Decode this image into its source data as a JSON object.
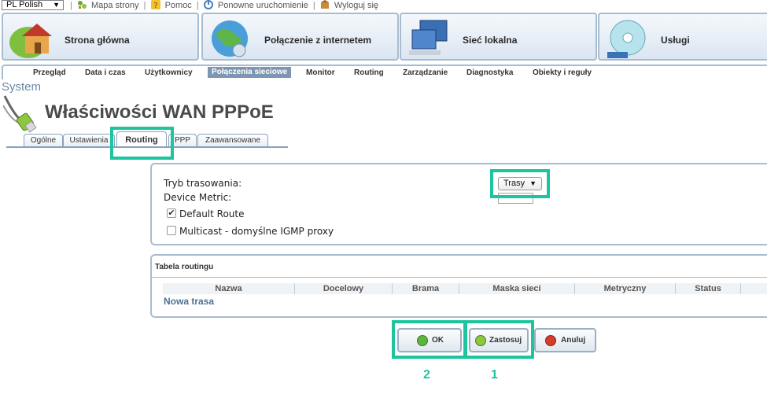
{
  "topbar": {
    "language": "PL Polish",
    "links": [
      "Mapa strony",
      "Pomoc",
      "Ponowne uruchomienie",
      "Wyloguj się"
    ]
  },
  "main_nav": [
    {
      "label": "Strona główna",
      "icon": "house-icon"
    },
    {
      "label": "Połączenie z internetem",
      "icon": "globe-icon"
    },
    {
      "label": "Sieć lokalna",
      "icon": "network-computers-icon"
    },
    {
      "label": "Usługi",
      "icon": "cd-disc-icon"
    }
  ],
  "sub_nav": [
    {
      "label": "Przegląd"
    },
    {
      "label": "Data i czas"
    },
    {
      "label": "Użytkownicy"
    },
    {
      "label": "Połączenia sieciowe",
      "active": true
    },
    {
      "label": "Monitor"
    },
    {
      "label": "Routing"
    },
    {
      "label": "Zarządzanie"
    },
    {
      "label": "Diagnostyka"
    },
    {
      "label": "Obiekty i reguły"
    }
  ],
  "section_label": "System",
  "page_title": "Właściwości WAN PPPoE",
  "tabs": [
    {
      "label": "Ogólne"
    },
    {
      "label": "Ustawienia"
    },
    {
      "label": "Routing",
      "active": true
    },
    {
      "label": "PPP"
    },
    {
      "label": "Zaawansowane"
    }
  ],
  "form": {
    "routing_mode_label": "Tryb trasowania:",
    "routing_mode_value": "Trasy",
    "device_metric_label": "Device Metric:",
    "device_metric_value": "",
    "default_route_label": "Default Route",
    "default_route_checked": true,
    "multicast_label": "Multicast - domyślne IGMP proxy",
    "multicast_checked": false
  },
  "routing_table": {
    "title": "Tabela routingu",
    "columns": [
      "Nazwa",
      "Docelowy",
      "Brama",
      "Maska sieci",
      "Metryczny",
      "Status"
    ],
    "new_route_link": "Nowa trasa"
  },
  "buttons": {
    "ok": "OK",
    "apply": "Zastosuj",
    "cancel": "Anuluj"
  },
  "annotations": {
    "ok_step": "2",
    "apply_step": "1",
    "highlight_color": "#1ec49e"
  },
  "colors": {
    "accent_border": "#a8bcd0",
    "active_subnav": "#7d96b1",
    "link": "#4d6f96"
  }
}
